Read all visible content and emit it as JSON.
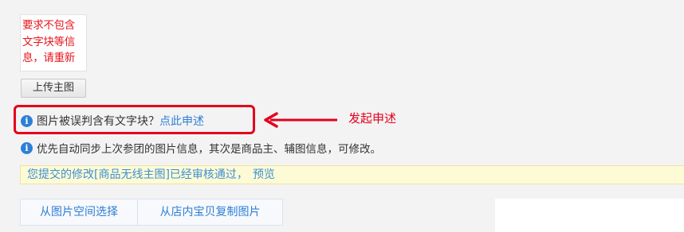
{
  "preview": {
    "warning_lines": [
      "要求不包含",
      "文字块等信",
      "息，请重新"
    ]
  },
  "upload_button": "上传主图",
  "appeal": {
    "text": "图片被误判含有文字块？",
    "link": "点此申述"
  },
  "annotation": {
    "callout": "发起申述"
  },
  "sync_info": "优先自动同步上次参团的图片信息，其次是商品主、辅图信息，可修改。",
  "notice": {
    "text": "您提交的修改[商品无线主图]已经审核通过，",
    "link": "预览"
  },
  "tabs": [
    "从图片空间选择",
    "从店内宝贝复制图片"
  ],
  "colors": {
    "accent": "#2e7ed6",
    "warning_red": "#e4001b",
    "notice_bg": "#fdfbd6"
  }
}
